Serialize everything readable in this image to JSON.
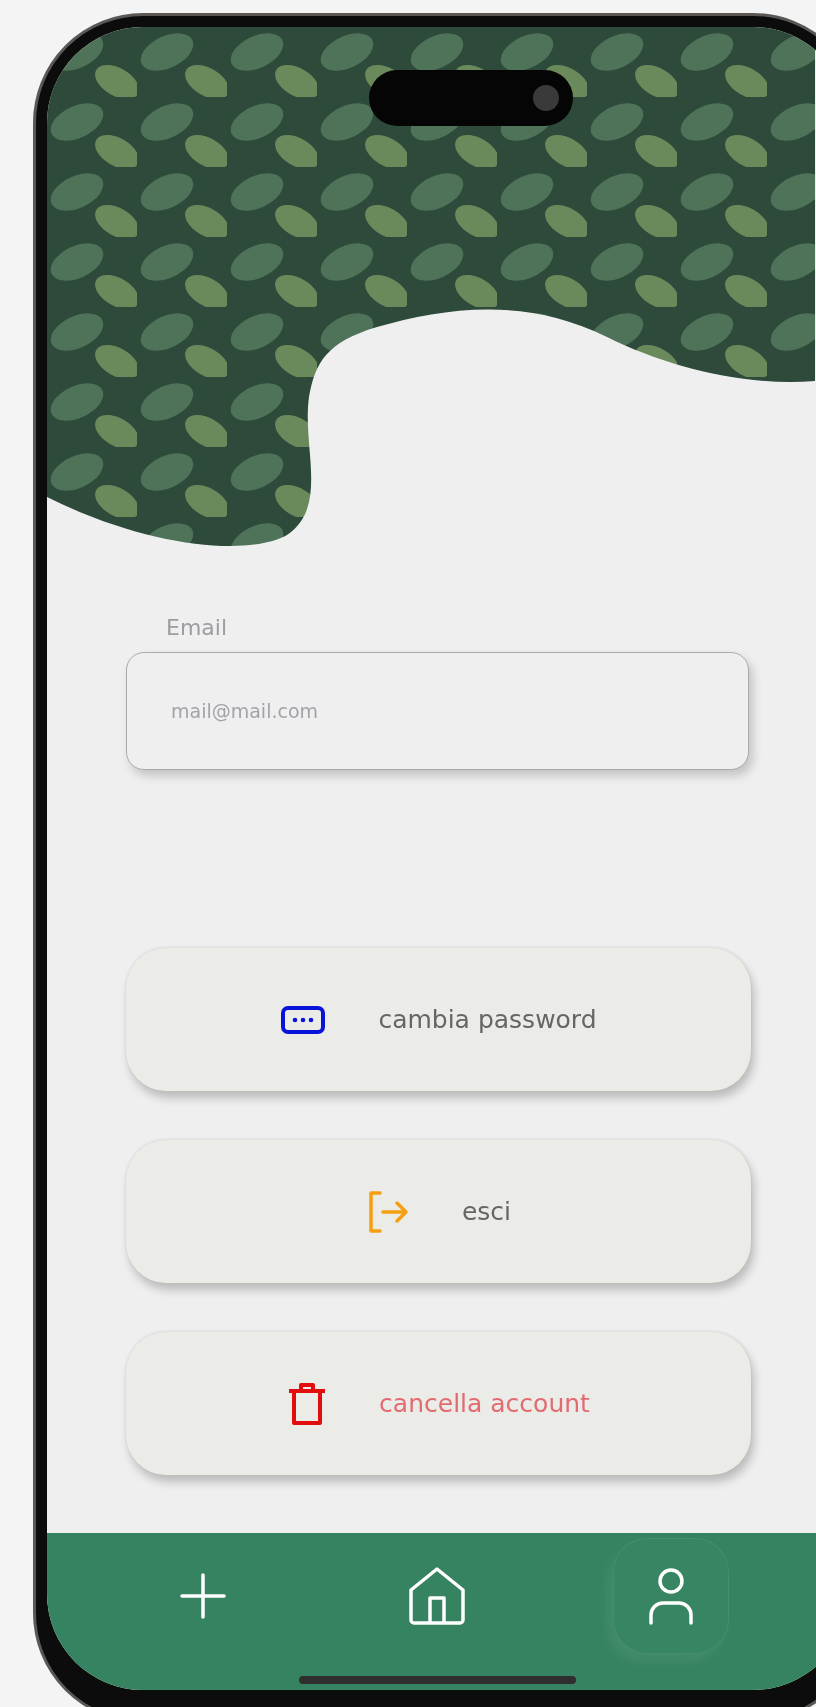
{
  "email": {
    "label": "Email",
    "placeholder": "mail@mail.com"
  },
  "actions": [
    {
      "kind": "password",
      "label": "cambia password"
    },
    {
      "kind": "logout",
      "label": "esci"
    },
    {
      "kind": "delete",
      "label": "cancella account"
    }
  ],
  "nav": [
    {
      "kind": "add",
      "selected": false
    },
    {
      "kind": "home",
      "selected": false
    },
    {
      "kind": "profile",
      "selected": true
    }
  ]
}
